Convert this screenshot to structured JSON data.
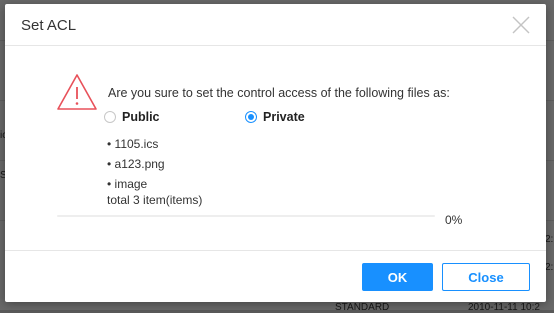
{
  "background": {
    "fragments": [
      "ic",
      "S",
      "2:",
      "2:",
      "STANDARD",
      "2010-11-11 10:2"
    ]
  },
  "dialog": {
    "title": "Set ACL",
    "question": "Are you sure to set the control access of the following files as:",
    "options": [
      {
        "label": "Public",
        "checked": false
      },
      {
        "label": "Private",
        "checked": true
      }
    ],
    "files": [
      "• 1105.ics",
      "• a123.png",
      "• image"
    ],
    "total": "total 3 item(items)",
    "progress_percent": 0,
    "progress_label": "0%",
    "buttons": {
      "ok": "OK",
      "close": "Close"
    }
  },
  "colors": {
    "accent": "#1890ff",
    "warning": "#e8515a"
  },
  "icons": {
    "close": "close-icon",
    "warning": "warning-icon"
  }
}
